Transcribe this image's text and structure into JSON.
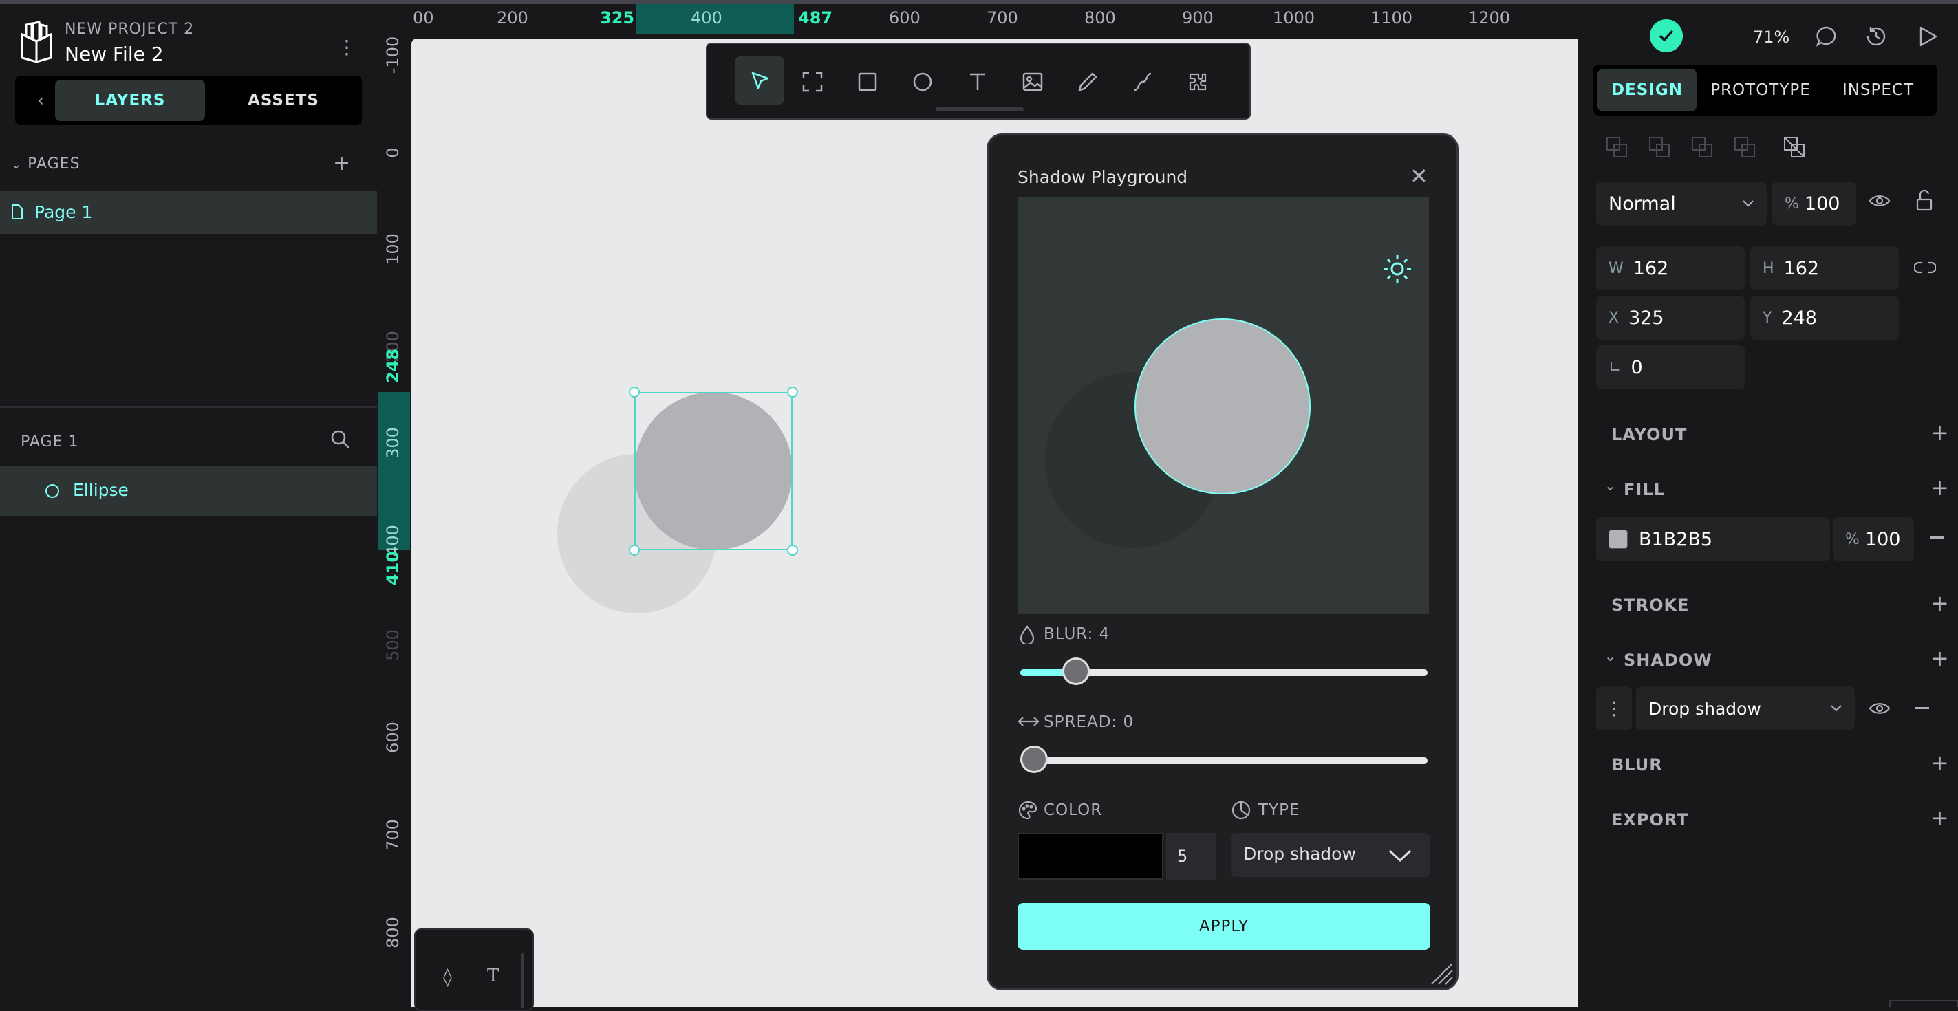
{
  "project": {
    "name": "NEW PROJECT 2",
    "file": "New File 2"
  },
  "left_tabs": {
    "layers": "LAYERS",
    "assets": "ASSETS"
  },
  "pages": {
    "header": "PAGES",
    "items": [
      {
        "label": "Page 1"
      }
    ]
  },
  "layers": {
    "header": "PAGE 1",
    "items": [
      {
        "label": "Ellipse"
      }
    ]
  },
  "ruler_h": {
    "ticks": [
      "00",
      "200",
      "325",
      "400",
      "487",
      "600",
      "700",
      "800",
      "900",
      "1000",
      "1100",
      "1200"
    ]
  },
  "ruler_v": {
    "ticks": [
      "-100",
      "0",
      "100",
      "200",
      "248",
      "300",
      "400",
      "410",
      "500",
      "600",
      "700",
      "800"
    ]
  },
  "toolbar": {
    "tools": [
      "pointer-icon",
      "board-icon",
      "rectangle-icon",
      "ellipse-icon",
      "text-icon",
      "image-icon",
      "pen-icon",
      "path-icon",
      "plugins-icon"
    ]
  },
  "header_right": {
    "zoom": "71%"
  },
  "right_tabs": {
    "design": "DESIGN",
    "prototype": "PROTOTYPE",
    "inspect": "INSPECT"
  },
  "layer_props": {
    "blend": "Normal",
    "opacity_sym": "%",
    "opacity": "100"
  },
  "measures": {
    "w_label": "W",
    "w": "162",
    "h_label": "H",
    "h": "162",
    "x_label": "X",
    "x": "325",
    "y_label": "Y",
    "y": "248",
    "radius": "0"
  },
  "sections": {
    "layout": "LAYOUT",
    "fill": "FILL",
    "stroke": "STROKE",
    "shadow": "SHADOW",
    "blur": "BLUR",
    "export": "EXPORT"
  },
  "fill": {
    "hex": "B1B2B5",
    "color": "#b1b2b5",
    "opacity_sym": "%",
    "opacity": "100"
  },
  "shadow_row": {
    "type": "Drop shadow"
  },
  "modal": {
    "title": "Shadow Playground",
    "blur_label": "BLUR: 4",
    "blur_fraction": 0.11,
    "spread_label": "SPREAD: 0",
    "spread_fraction": 0.0,
    "color_label": "COLOR",
    "color_value": "5",
    "color_swatch": "#000000",
    "type_label": "TYPE",
    "type_value": "Drop shadow",
    "apply": "APPLY"
  },
  "colors": {
    "accent": "#7efff5",
    "success": "#31efb8"
  }
}
